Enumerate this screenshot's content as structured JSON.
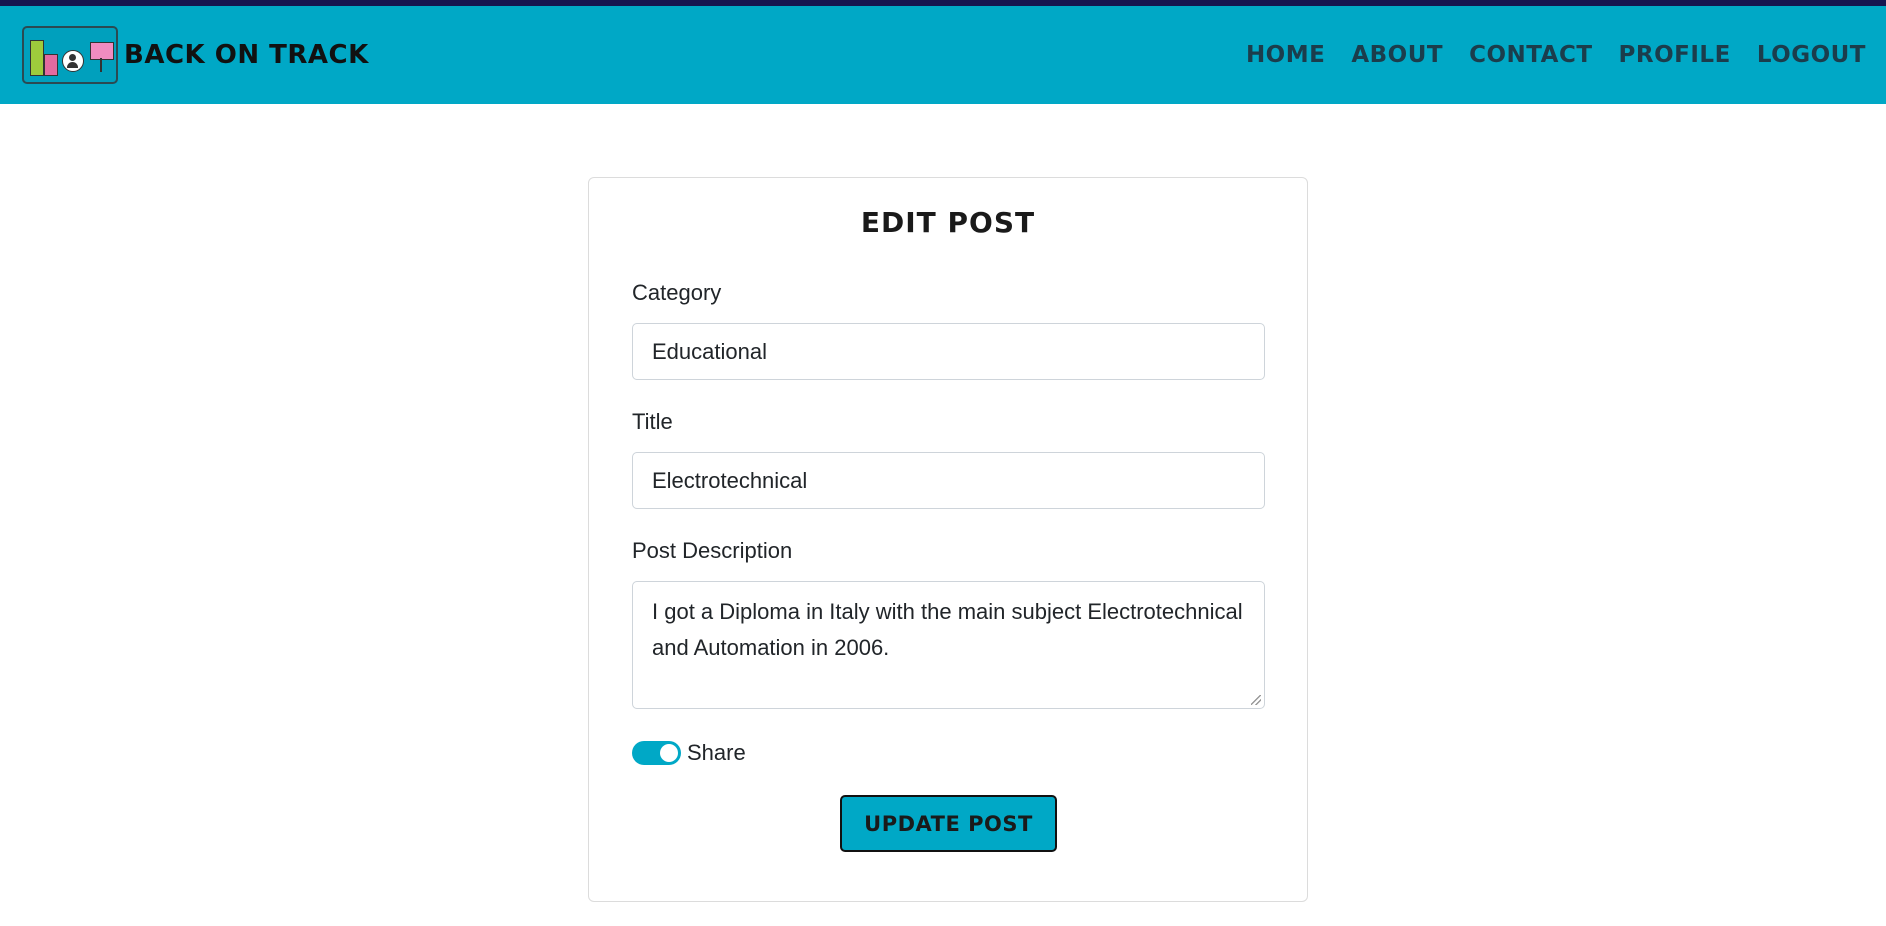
{
  "header": {
    "brand": "BACK ON TRACK",
    "nav": [
      "HOME",
      "ABOUT",
      "CONTACT",
      "PROFILE",
      "LOGOUT"
    ]
  },
  "form": {
    "title": "EDIT POST",
    "category_label": "Category",
    "category_value": "Educational",
    "title_label": "Title",
    "title_value": "Electrotechnical",
    "description_label": "Post Description",
    "description_value": "I got a Diploma in Italy with the main subject Electrotechnical and Automation in 2006.",
    "share_label": "Share",
    "share_checked": true,
    "submit_label": "UPDATE POST"
  },
  "colors": {
    "accent": "#00a8c6",
    "top_strip": "#161650",
    "nav_text": "#1b3d4c"
  }
}
